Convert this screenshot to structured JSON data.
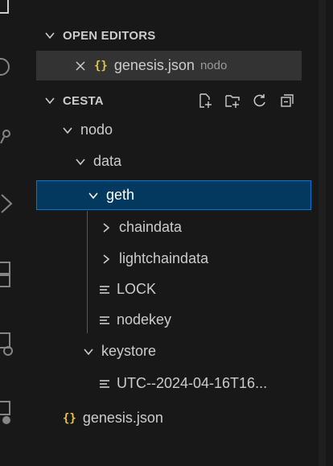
{
  "open_editors": {
    "title": "OPEN EDITORS",
    "items": [
      {
        "name": "genesis.json",
        "folder": "nodo"
      }
    ]
  },
  "workspace": {
    "title": "CESTA",
    "tree": [
      {
        "label": "nodo",
        "type": "folder",
        "expanded": true
      },
      {
        "label": "data",
        "type": "folder",
        "expanded": true
      },
      {
        "label": "geth",
        "type": "folder",
        "expanded": true,
        "selected": true
      },
      {
        "label": "chaindata",
        "type": "folder",
        "expanded": false
      },
      {
        "label": "lightchaindata",
        "type": "folder",
        "expanded": false
      },
      {
        "label": "LOCK",
        "type": "file"
      },
      {
        "label": "nodekey",
        "type": "file"
      },
      {
        "label": "keystore",
        "type": "folder",
        "expanded": true
      },
      {
        "label": "UTC--2024-04-16T16...",
        "type": "file"
      },
      {
        "label": "genesis.json",
        "type": "json-file"
      }
    ]
  },
  "icons": {
    "chevron_expanded": "chevron-down-icon",
    "chevron_collapsed": "chevron-right-icon",
    "json": "json-file-icon",
    "file": "text-lines-icon",
    "close": "close-icon",
    "header_actions": [
      "new-file-icon",
      "new-folder-icon",
      "refresh-icon",
      "collapse-all-icon"
    ]
  },
  "colors": {
    "background": "#181818",
    "selection_bg": "#03395e",
    "selection_border": "#0078d4",
    "json_icon": "#e8c547",
    "text": "#cccccc"
  }
}
